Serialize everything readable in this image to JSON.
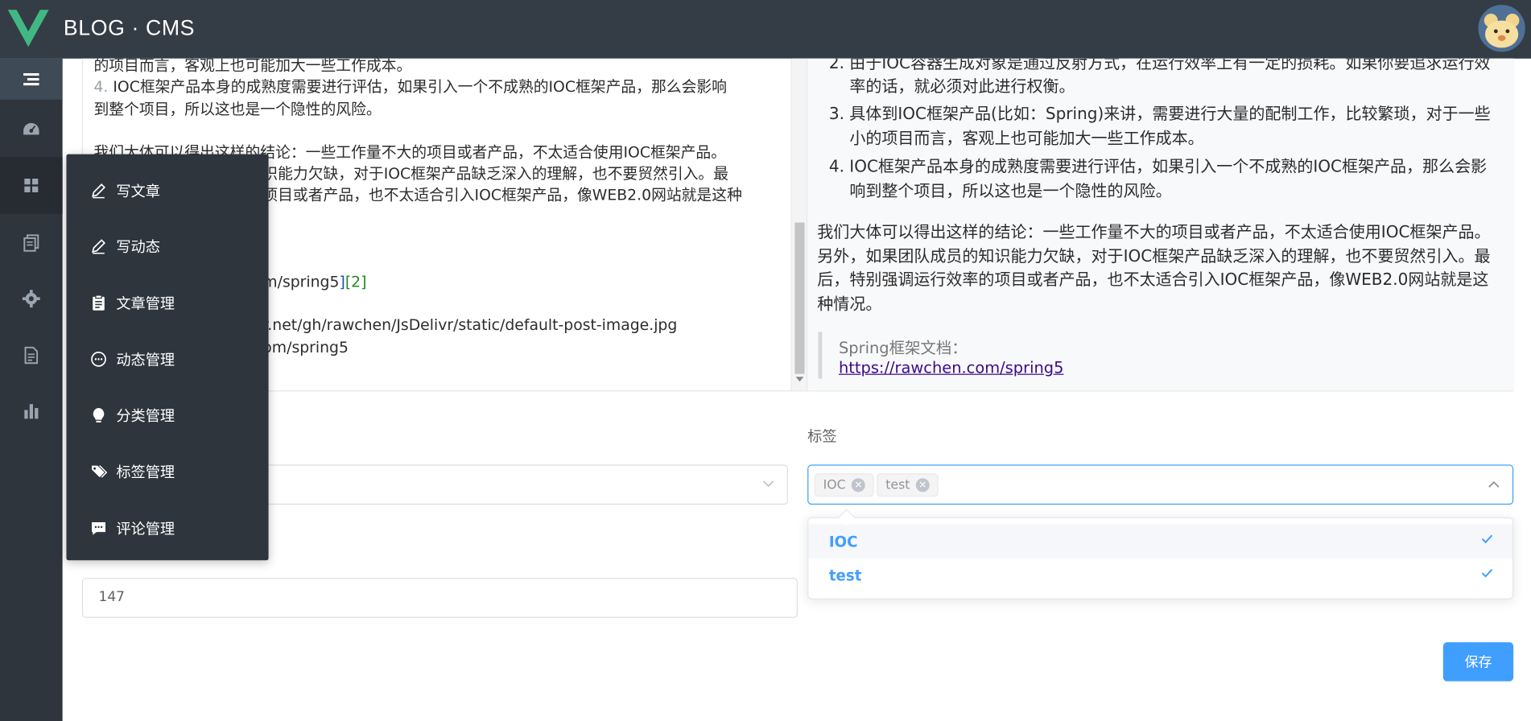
{
  "header": {
    "brand": "BLOG · CMS"
  },
  "sidebar": {
    "icons": [
      "menu-toggle-icon",
      "dashboard-icon",
      "apps-icon",
      "copy-icon",
      "settings-icon",
      "document-icon",
      "bar-chart-icon"
    ]
  },
  "flyout": {
    "items": [
      {
        "label": "写文章",
        "icon": "pencil-icon"
      },
      {
        "label": "写动态",
        "icon": "pencil-icon"
      },
      {
        "label": "文章管理",
        "icon": "clipboard-icon"
      },
      {
        "label": "动态管理",
        "icon": "chat-bubble-icon"
      },
      {
        "label": "分类管理",
        "icon": "bulb-icon"
      },
      {
        "label": "标签管理",
        "icon": "tags-icon"
      },
      {
        "label": "评论管理",
        "icon": "comment-icon"
      }
    ]
  },
  "editor": {
    "lines": {
      "l1": "的项目而言，客观上也可能加大一些工作成本。",
      "l2_num": "4.",
      "l2": " IOC框架产品本身的成熟度需要进行评估，如果引入一个不成熟的IOC框架产品，那么会影响",
      "l3": "到整个项目，所以这也是一个隐性的风险。",
      "l4": "我们大体可以得出这样的结论：一些工作量不大的项目或者产品，不太适合使用IOC框架产品。",
      "l5": "识能力欠缺，对于IOC框架产品缺乏深入的理解，也不要贸然引入。最",
      "l6": "项目或者产品，也不太适合引入IOC框架产品，像WEB2.0网站就是这种",
      "l7_a": "m/spring5",
      "l7_b": "]",
      "l7_c": "[2]",
      "l8": "r.net/gh/rawchen/JsDelivr/static/default-post-image.jpg",
      "l9": "om/spring5"
    }
  },
  "preview": {
    "p1": "2. 由于IOC容器生成对象是通过反射方式，在运行效率上有一定的损耗。如果你要追求运行效",
    "p1b": "率的话，就必须对此进行权衡。",
    "p2": "3. 具体到IOC框架产品(比如：Spring)来讲，需要进行大量的配制工作，比较繁琐，对于一些",
    "p2b": "小的项目而言，客观上也可能加大一些工作成本。",
    "p3": "4. IOC框架产品本身的成熟度需要进行评估，如果引入一个不成熟的IOC框架产品，那么会影",
    "p3b": "响到整个项目，所以这也是一个隐性的风险。",
    "p4a": "我们大体可以得出这样的结论：一些工作量不大的项目或者产品，不太适合使用IOC框架产品。",
    "p4b": "另外，如果团队成员的知识能力欠缺，对于IOC框架产品缺乏深入的理解，也不要贸然引入。最",
    "p4c": "后，特别强调运行效率的项目或者产品，也不太适合引入IOC框架产品，像WEB2.0网站就是这",
    "p4d": "种情况。",
    "quote_title": "Spring框架文档：",
    "quote_link": "https://rawchen.com/spring5"
  },
  "form": {
    "tags_label": "标签",
    "selected_tags": [
      "IOC",
      "test"
    ],
    "tag_options": [
      {
        "label": "IOC",
        "selected": true
      },
      {
        "label": "test",
        "selected": true
      }
    ],
    "number_value": "147",
    "save_label": "保存"
  },
  "colors": {
    "header_bg": "#343d46",
    "sidebar_bg": "#2e353c",
    "accent": "#409eff",
    "logo_green": "#41b883"
  }
}
